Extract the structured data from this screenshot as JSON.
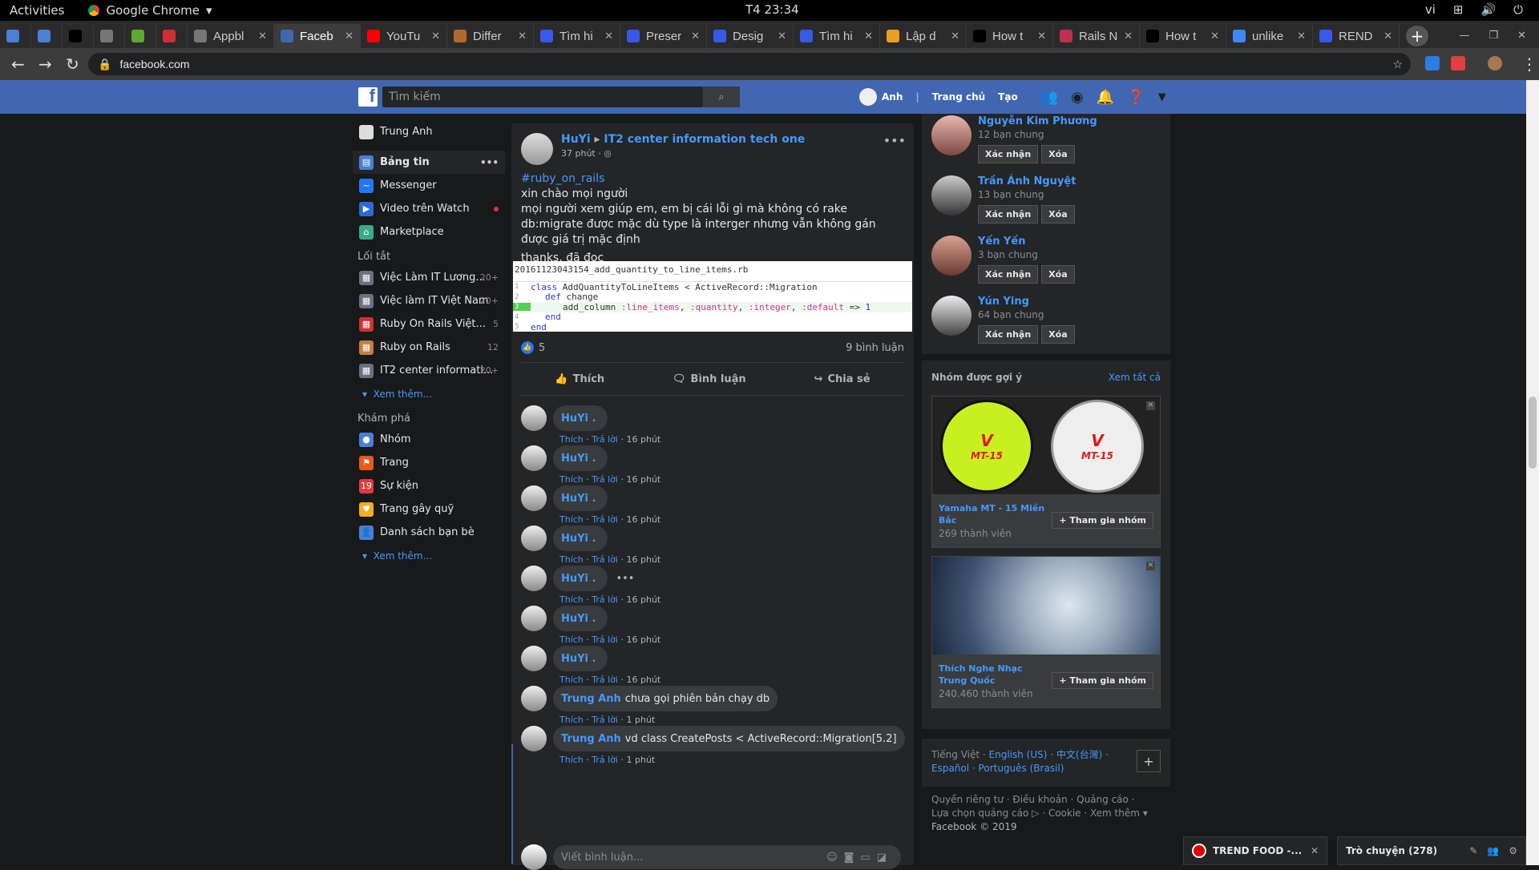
{
  "system": {
    "activities": "Activities",
    "app": "Google Chrome",
    "clock": "T4 23:34",
    "lang": "vi"
  },
  "tabs": [
    {
      "title": "",
      "color": "#4a7fd4"
    },
    {
      "title": "",
      "color": "#4a7fd4"
    },
    {
      "title": "",
      "color": "#000000"
    },
    {
      "title": "",
      "color": "#777777"
    },
    {
      "title": "",
      "color": "#5ca832"
    },
    {
      "title": "",
      "color": "#d03030"
    },
    {
      "title": "Appbl",
      "color": "#777777"
    },
    {
      "title": "Faceb",
      "color": "#4267b2"
    },
    {
      "title": "YouTu",
      "color": "#ff0000"
    },
    {
      "title": "Differ",
      "color": "#b06a2c"
    },
    {
      "title": "Tìm hi",
      "color": "#3858e8"
    },
    {
      "title": "Preser",
      "color": "#3858e8"
    },
    {
      "title": "Desig",
      "color": "#3858e8"
    },
    {
      "title": "Tìm hi",
      "color": "#3858e8"
    },
    {
      "title": "Lập d",
      "color": "#e8a020"
    },
    {
      "title": "How t",
      "color": "#000000"
    },
    {
      "title": "Rails N",
      "color": "#c03050"
    },
    {
      "title": "How t",
      "color": "#000000"
    },
    {
      "title": "unlike",
      "color": "#4285f4"
    },
    {
      "title": "REND",
      "color": "#3858e8"
    }
  ],
  "address": {
    "url": "facebook.com"
  },
  "fb": {
    "search_placeholder": "Tìm kiếm",
    "user": "Anh",
    "home": "Trang chủ",
    "create": "Tạo"
  },
  "left_nav": {
    "profile": "Trung Anh",
    "main": [
      {
        "label": "Bảng tin",
        "extra": "•••"
      },
      {
        "label": "Messenger"
      },
      {
        "label": "Video trên Watch"
      },
      {
        "label": "Marketplace"
      }
    ],
    "shortcuts_title": "Lối tắt",
    "shortcuts": [
      {
        "label": "Việc Làm IT Lương...",
        "count": "20+"
      },
      {
        "label": "Việc làm IT Việt Nam",
        "count": "20+"
      },
      {
        "label": "Ruby On Rails Việt...",
        "count": "5"
      },
      {
        "label": "Ruby on Rails",
        "count": "12"
      },
      {
        "label": "IT2 center informati...",
        "count": "20+"
      }
    ],
    "see_more": "Xem thêm...",
    "explore_title": "Khám phá",
    "explore": [
      {
        "label": "Nhóm"
      },
      {
        "label": "Trang"
      },
      {
        "label": "Sự kiện"
      },
      {
        "label": "Trang gây quỹ"
      },
      {
        "label": "Danh sách bạn bè"
      }
    ]
  },
  "post": {
    "author": "HuYi",
    "group": "IT2 center information tech one",
    "time": "37 phút · ",
    "hashtag": "#ruby_on_rails",
    "line1": "xin chào mọi người",
    "line2": "mọi người xem giúp em, em bị cái lỗi gì mà không có rake db:migrate được mặc dù type là interger nhưng vẫn không gán được giá trị mặc định",
    "line3": "thanks, đã đọc",
    "code_file": "20161123043154_add_quantity_to_line_items.rb",
    "code": {
      "l1_kw": "class",
      "l1_rest": " AddQuantityToLineItems < ActiveRecord::Migration",
      "l2_kw": "def",
      "l2_rest": " change",
      "l3_a": "add_column ",
      "l3_b": ":line_items",
      "l3_c": ", ",
      "l3_d": ":quantity",
      "l3_e": ", ",
      "l3_f": ":integer",
      "l3_g": ", ",
      "l3_h": ":default",
      "l3_i": " => ",
      "l3_j": "1",
      "l4": "end",
      "l5": "end"
    },
    "likes": "5",
    "comments_count": "9 bình luận",
    "action_like": "Thích",
    "action_comment": "Bình luận",
    "action_share": "Chia sẻ",
    "comments": [
      {
        "name": "HuYi .",
        "text": "",
        "time": "16 phút"
      },
      {
        "name": "HuYi .",
        "text": "",
        "time": "16 phút"
      },
      {
        "name": "HuYi .",
        "text": "",
        "time": "16 phút"
      },
      {
        "name": "HuYi .",
        "text": "",
        "time": "16 phút"
      },
      {
        "name": "HuYi .",
        "text": "",
        "time": "16 phút"
      },
      {
        "name": "HuYi .",
        "text": "",
        "time": "16 phút"
      },
      {
        "name": "HuYi .",
        "text": "",
        "time": "16 phút"
      },
      {
        "name": "Trung Anh",
        "text": "chưa gọi phiên bản chạy db",
        "time": "1 phút"
      },
      {
        "name": "Trung Anh",
        "text": "vd class CreatePosts < ActiveRecord::Migration[5.2]",
        "time": "1 phút"
      }
    ],
    "like_lbl": "Thích",
    "reply_lbl": "Trả lời",
    "write_placeholder": "Viết bình luận..."
  },
  "friends": [
    {
      "name": "Nguyễn Kim Phương",
      "mutual": "12 bạn chung"
    },
    {
      "name": "Trần Ánh Nguyệt",
      "mutual": "13 bạn chung"
    },
    {
      "name": "Yến Yến",
      "mutual": "3 bạn chung"
    },
    {
      "name": "Yún Ying",
      "mutual": "64 bạn chung"
    }
  ],
  "friend_confirm": "Xác nhận",
  "friend_delete": "Xóa",
  "groups": {
    "title": "Nhóm được gợi ý",
    "see_all": "Xem tất cả",
    "join": "Tham gia nhóm",
    "items": [
      {
        "name": "Yamaha MT - 15 Miền Bắc",
        "members": "269 thành viên"
      },
      {
        "name": "Thích Nghe Nhạc Trung Quốc",
        "members": "240.460 thành viên"
      }
    ]
  },
  "languages": {
    "current": "Tiếng Việt · ",
    "l1": "English (US)",
    "sep1": " · ",
    "l2": "中文(台灣)",
    "sep2": " · ",
    "l3": "Español",
    "sep3": " · ",
    "l4": "Português (Brasil)"
  },
  "footer": {
    "line1": "Quyền riêng tư · Điều khoản · Quảng cáo ·",
    "line2": "Lựa chọn quảng cáo ▷ · Cookie · Xem thêm ▾",
    "line3": "Facebook © 2019"
  },
  "chat": {
    "trend": "TREND FOOD -...",
    "chat": "Trò chuyện (278)"
  }
}
